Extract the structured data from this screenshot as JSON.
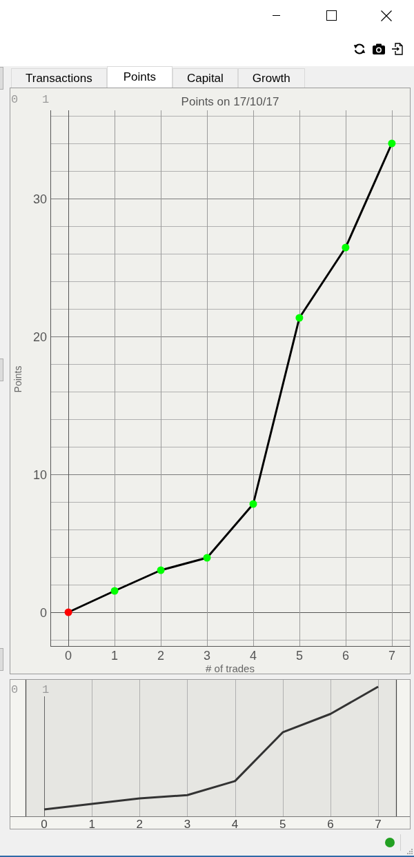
{
  "tabs": [
    {
      "label": "Transactions",
      "selected": false
    },
    {
      "label": "Points",
      "selected": true
    },
    {
      "label": "Capital",
      "selected": false
    },
    {
      "label": "Growth",
      "selected": false
    }
  ],
  "plot": {
    "corner_labels": [
      "0",
      "1"
    ],
    "chart_data": {
      "type": "line",
      "title": "Points on 17/10/17",
      "xlabel": "# of trades",
      "ylabel": "Points",
      "x": [
        0,
        1,
        2,
        3,
        4,
        5,
        6,
        7
      ],
      "series": [
        {
          "color": "#000000",
          "marker": {
            "shape": "circle",
            "color": "#00ff00"
          },
          "values": [
            0,
            1.55,
            3.05,
            3.95,
            7.85,
            21.35,
            26.45,
            34.0
          ]
        },
        {
          "color": "#ff0000",
          "marker": {
            "shape": "circle"
          },
          "values": [
            0,
            null,
            null,
            null,
            null,
            null,
            null,
            null
          ]
        }
      ],
      "xlim": [
        -0.39,
        7.39
      ],
      "ylim": [
        -2.45,
        36.4
      ],
      "xticks": [
        0,
        1,
        2,
        3,
        4,
        5,
        6,
        7
      ],
      "yticks": [
        0,
        10,
        20,
        30
      ],
      "grid": true
    }
  },
  "overview": {
    "corner_labels": [
      "0",
      "1"
    ],
    "xticks": [
      "0",
      "1",
      "2",
      "3",
      "4",
      "5",
      "6",
      "7"
    ]
  }
}
